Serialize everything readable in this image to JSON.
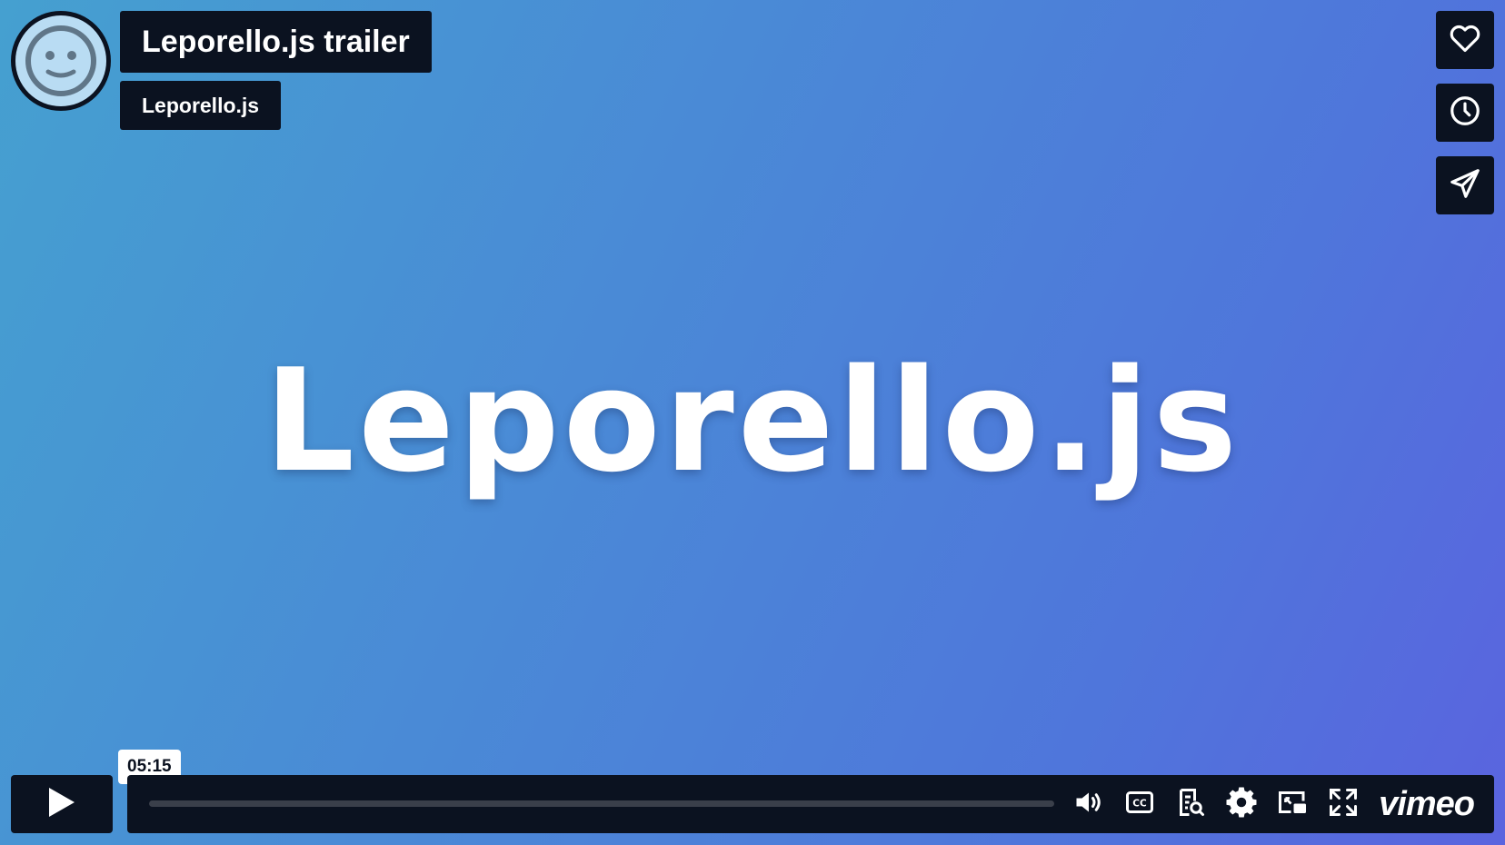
{
  "video": {
    "title": "Leporello.js trailer",
    "byline": "Leporello.js",
    "frame_text": "Leporello.js"
  },
  "side_actions": [
    {
      "name": "like",
      "icon": "heart-icon"
    },
    {
      "name": "watch-later",
      "icon": "clock-icon"
    },
    {
      "name": "share",
      "icon": "paper-plane-icon"
    }
  ],
  "controls": {
    "play_icon": "play-icon",
    "time_tooltip": "05:15",
    "progress": 0,
    "icons": [
      "volume-icon",
      "cc-icon",
      "transcript-icon",
      "settings-gear-icon",
      "picture-in-picture-icon",
      "fullscreen-icon"
    ],
    "brand": "vimeo"
  },
  "colors": {
    "panel": "#0b1220",
    "background_start": "#45a0d0",
    "background_end": "#5a64df",
    "text": "#ffffff"
  }
}
